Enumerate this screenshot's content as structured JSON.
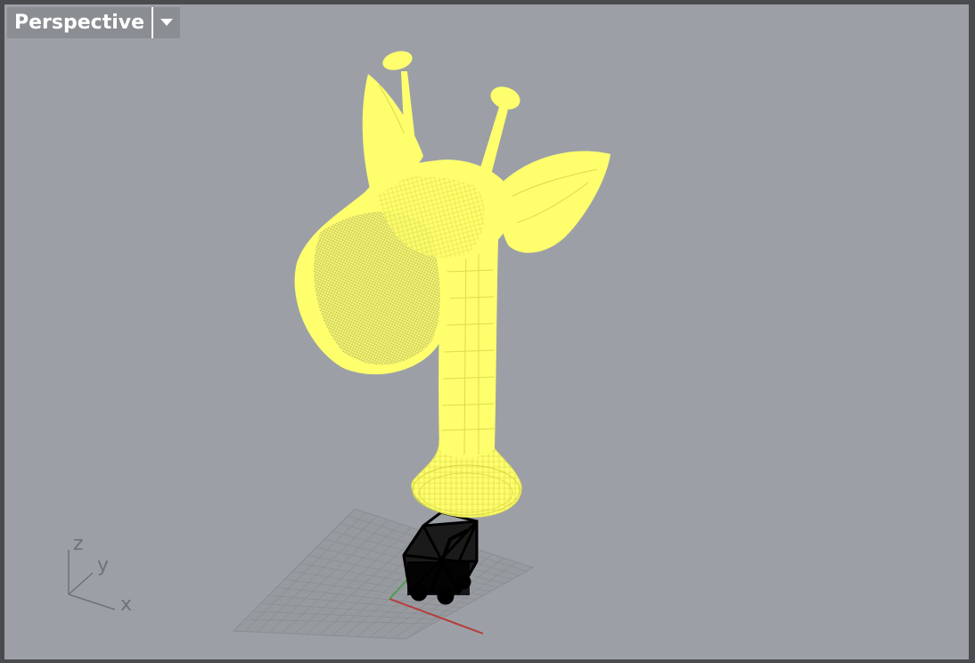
{
  "viewport": {
    "name": "Perspective",
    "dropdown_icon": "triangle-down-icon",
    "background_color": "#9ca0a6"
  },
  "axes_widget": {
    "x_label": "x",
    "y_label": "y",
    "z_label": "z"
  },
  "scene": {
    "object_color": "#ffff66",
    "wire_color": "#e8e84a",
    "frame_color": "#000000",
    "grid_color": "#8e9196",
    "x_axis_color": "#b83a3a",
    "y_axis_color": "#3aa03a"
  }
}
